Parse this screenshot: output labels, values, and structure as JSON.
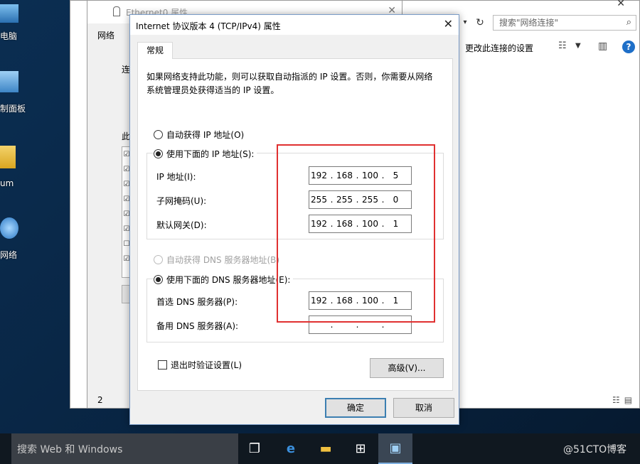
{
  "desktop": {
    "icons": [
      {
        "label": "电脑"
      },
      {
        "label": "制面板"
      },
      {
        "label": "um"
      },
      {
        "label": "网络"
      }
    ]
  },
  "network_window": {
    "search_placeholder": "搜索\"网络连接\"",
    "toolbar_change": "更改此连接的设置",
    "help": "?"
  },
  "ethernet_window": {
    "title": "Ethernet0 属性",
    "tab_partial": "网络",
    "label_partial_1": "连",
    "label_partial_2": "此",
    "status_num": "2"
  },
  "dialog": {
    "title": "Internet 协议版本 4 (TCP/IPv4) 属性",
    "tab": "常规",
    "intro": "如果网络支持此功能，则可以获取自动指派的 IP 设置。否则，你需要从网络系统管理员处获得适当的 IP 设置。",
    "ip_auto": "自动获得 IP 地址(O)",
    "ip_manual": "使用下面的 IP 地址(S):",
    "ip_label": "IP 地址(I):",
    "mask_label": "子网掩码(U):",
    "gateway_label": "默认网关(D):",
    "ip": [
      "192",
      "168",
      "100",
      "5"
    ],
    "mask": [
      "255",
      "255",
      "255",
      "0"
    ],
    "gateway": [
      "192",
      "168",
      "100",
      "1"
    ],
    "dns_auto": "自动获得 DNS 服务器地址(B)",
    "dns_manual": "使用下面的 DNS 服务器地址(E):",
    "dns1_label": "首选 DNS 服务器(P):",
    "dns2_label": "备用 DNS 服务器(A):",
    "dns1": [
      "192",
      "168",
      "100",
      "1"
    ],
    "dns2": [
      "",
      "",
      "",
      ""
    ],
    "validate": "退出时验证设置(L)",
    "advanced": "高级(V)...",
    "ok": "确定",
    "cancel": "取消"
  },
  "taskbar": {
    "search": "搜索 Web 和 Windows",
    "tray": "@51CTO博客"
  },
  "colors": {
    "highlight_box": "#e03030",
    "desktop": "#0b2e52",
    "taskbar": "#101820"
  }
}
